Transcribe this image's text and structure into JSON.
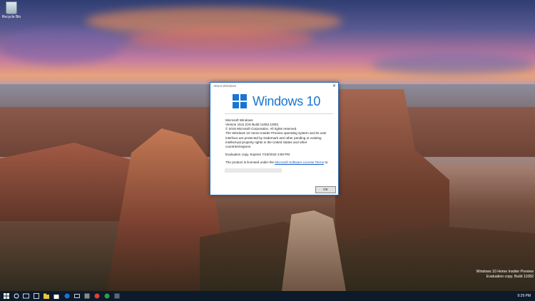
{
  "desktop": {
    "icons": [
      {
        "label": "Recycle Bin"
      }
    ],
    "watermark": {
      "line1": "Windows 10 Home Insider Preview",
      "line2": "Evaluation copy. Build 11082"
    }
  },
  "dialog": {
    "title": "About Windows",
    "logo_text": "Windows 10",
    "lines": {
      "product": "Microsoft Windows",
      "version": "Version 1511 (OS Build 11082.1000)",
      "copyright": "© 2016 Microsoft Corporation. All rights reserved.",
      "description": "The Windows 10 Home Insider Preview operating system and its user interface are protected by trademark and other pending or existing intellectual property rights in the United States and other countries/regions.",
      "expiry": "Evaluation copy. Expires 7/15/2016 3:59 PM",
      "license_prefix": "The product is licensed under the",
      "license_link": "Microsoft Software License Terms",
      "license_suffix": "to:"
    },
    "ok_label": "OK",
    "close_glyph": "✕"
  },
  "taskbar": {
    "clock": "9:29 PM",
    "colors": {
      "bg": "#0c1a2a",
      "accent": "#1a75d2"
    }
  }
}
